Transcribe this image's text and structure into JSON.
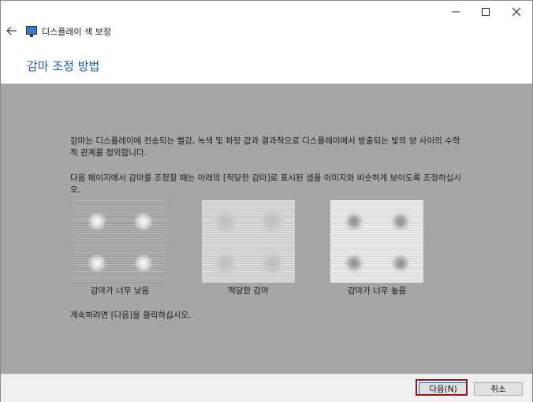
{
  "window": {
    "app_title": "디스플레이 색 보정",
    "heading": "감마 조정 방법"
  },
  "content": {
    "paragraph1": "감마는 디스플레이에 전송되는 빨강, 녹색 및 파랑 값과 결과적으로 디스플레이에서 방출되는 빛의 양 사이의 수학적 관계를 정의합니다.",
    "paragraph2": "다음 페이지에서 감마를 조정할 때는 아래의 [적당한 감마]로 표시된 샘플 이미지와 비슷하게 보이도록 조정하십시오.",
    "samples": [
      {
        "label": "감마가 너무 낮음"
      },
      {
        "label": "적당한 감마"
      },
      {
        "label": "감마가 너무 높음"
      }
    ],
    "instruction": "계속하려면 [다음]을 클릭하십시오."
  },
  "buttons": {
    "next": "다음(N)",
    "cancel": "취소"
  },
  "colors": {
    "content_bg": "#a6a6a6",
    "heading": "#1d5aa8",
    "highlight": "#8b1a1a"
  }
}
